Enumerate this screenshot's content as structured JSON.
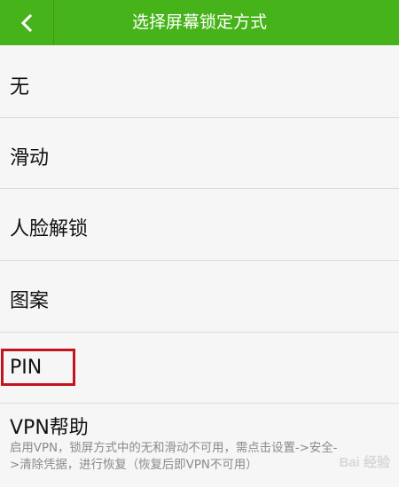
{
  "header": {
    "title": "选择屏幕锁定方式",
    "back_icon": "chevron-left-icon"
  },
  "options": [
    {
      "label": "无"
    },
    {
      "label": "滑动"
    },
    {
      "label": "人脸解锁"
    },
    {
      "label": "图案"
    },
    {
      "label": "PIN"
    },
    {
      "label": "VPN帮助",
      "description_line1": "启用VPN，锁屏方式中的无和滑动不可用，需点击设置->安全-",
      "description_line2": ">清除凭据，进行恢复（恢复后即VPN不可用）"
    }
  ],
  "watermark": "Bai 经验",
  "colors": {
    "header_bg": "#47b31a",
    "highlight": "#c4141b"
  }
}
